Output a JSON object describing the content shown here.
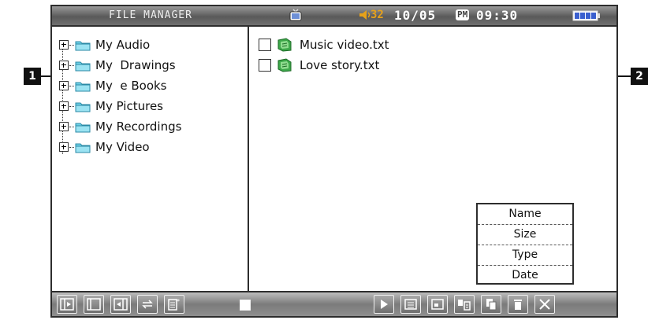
{
  "status_bar": {
    "title": "FILE MANAGER",
    "volume": "32",
    "date": "10/05",
    "ampm": "PM",
    "time": "09:30",
    "icons": [
      "tv-icon",
      "speaker-icon",
      "battery-icon"
    ],
    "volume_color": "#e6a11a"
  },
  "folder_tree": {
    "items": [
      {
        "label": "My Audio"
      },
      {
        "label": "My  Drawings"
      },
      {
        "label": "My  e Books"
      },
      {
        "label": "My Pictures"
      },
      {
        "label": "My Recordings"
      },
      {
        "label": "My Video"
      }
    ]
  },
  "file_list": {
    "files": [
      {
        "name": "Music video.txt"
      },
      {
        "name": "Love story.txt"
      }
    ]
  },
  "sort_menu": {
    "options": [
      "Name",
      "Size",
      "Type",
      "Date"
    ]
  },
  "toolbar": {
    "left_buttons": [
      "expand-icon",
      "panel-icon",
      "collapse-icon",
      "swap-icon",
      "select-all-icon"
    ],
    "right_buttons": [
      "play-icon",
      "list-view-icon",
      "window-icon",
      "move-icon",
      "copy-icon",
      "delete-icon",
      "close-icon"
    ]
  },
  "callouts": {
    "left": "1",
    "right": "2"
  }
}
